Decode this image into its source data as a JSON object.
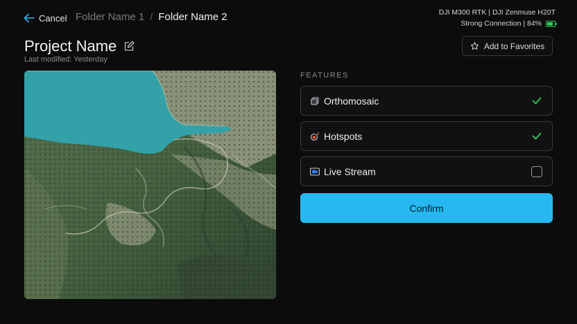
{
  "header": {
    "back_label": "Cancel",
    "breadcrumbs": [
      "Folder Name 1",
      "Folder Name 2"
    ],
    "breadcrumb_sep": "/"
  },
  "device": {
    "models": "DJI M300 RTK | DJI Zenmuse H20T",
    "connection": "Strong Connection | 84%",
    "battery_percent": 84,
    "battery_color": "#2ecc59"
  },
  "project": {
    "title": "Project Name",
    "modified": "Last modified: Yesterday"
  },
  "favorites_label": "Add to Favorites",
  "features": {
    "heading": "FEATURES",
    "items": [
      {
        "label": "Orthomosaic",
        "icon": "orthomosaic-icon",
        "checked": true
      },
      {
        "label": "Hotspots",
        "icon": "hotspots-icon",
        "checked": true
      },
      {
        "label": "Live Stream",
        "icon": "live-stream-icon",
        "checked": false
      }
    ]
  },
  "confirm_label": "Confirm",
  "colors": {
    "accent": "#27b8f2",
    "check": "#2ecc59",
    "water": "#34a3a8"
  }
}
